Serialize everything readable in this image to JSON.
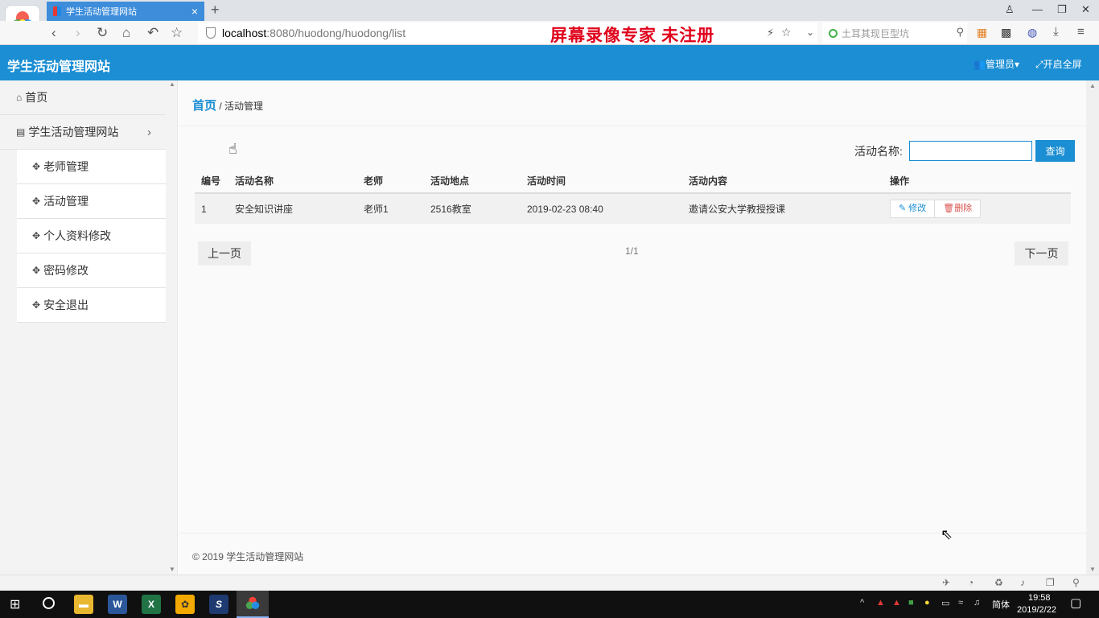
{
  "browser": {
    "tab_title": "学生活动管理网站",
    "tab_close": "×",
    "new_tab": "+",
    "url_host": "localhost",
    "url_path": ":8080/huodong/huodong/list",
    "watermark": "屏幕录像专家  未注册",
    "search_placeholder": "土耳其现巨型坑"
  },
  "header": {
    "title": "学生活动管理网站",
    "admin_label": "管理员",
    "fullscreen_label": "开启全屏"
  },
  "sidebar": {
    "home": "首页",
    "site": "学生活动管理网站",
    "site_arrow": "›",
    "items": [
      {
        "label": "老师管理"
      },
      {
        "label": "活动管理"
      },
      {
        "label": "个人资料修改"
      },
      {
        "label": "密码修改"
      },
      {
        "label": "安全退出"
      }
    ]
  },
  "breadcrumb": {
    "home": "首页",
    "separator": "/",
    "current": "活动管理"
  },
  "search": {
    "label": "活动名称:",
    "value": "",
    "button": "查询"
  },
  "table": {
    "headers": [
      "编号",
      "活动名称",
      "老师",
      "活动地点",
      "活动时间",
      "活动内容",
      "操作"
    ],
    "rows": [
      {
        "id": "1",
        "name": "安全知识讲座",
        "teacher": "老师1",
        "location": "2516教室",
        "time": "2019-02-23 08:40",
        "content": "邀请公安大学教授授课",
        "edit": "修改",
        "delete": "删除"
      }
    ]
  },
  "pagination": {
    "prev": "上一页",
    "info": "1/1",
    "next": "下一页"
  },
  "footer": {
    "text": "© 2019 学生活动管理网站"
  },
  "taskbar": {
    "ime": "简体",
    "time": "19:58",
    "date": "2019/2/22"
  },
  "colors": {
    "primary": "#1b8ed4",
    "danger": "#d9534f",
    "watermark": "#e0001b"
  }
}
